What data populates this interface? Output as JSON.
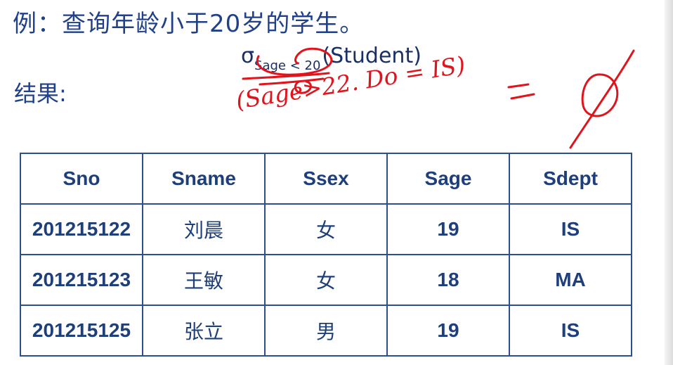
{
  "title": "例：查询年龄小于20岁的学生。",
  "formula": {
    "sigma": "σ",
    "subscript": "Sage < 20",
    "relation": "(Student)"
  },
  "result_label": "结果:",
  "annotation": {
    "handwritten": "(Sage>22. Do = IS)",
    "equals": "=",
    "empty_set": "∅",
    "color": "#e0141c"
  },
  "table": {
    "headers": [
      "Sno",
      "Sname",
      "Ssex",
      "Sage",
      "Sdept"
    ],
    "rows": [
      [
        "201215122",
        "刘晨",
        "女",
        "19",
        "IS"
      ],
      [
        "201215123",
        "王敏",
        "女",
        "18",
        "MA"
      ],
      [
        "201215125",
        "张立",
        "男",
        "19",
        "IS"
      ]
    ],
    "border_color": "#2c4f8f",
    "text_color": "#1f3f7a"
  }
}
